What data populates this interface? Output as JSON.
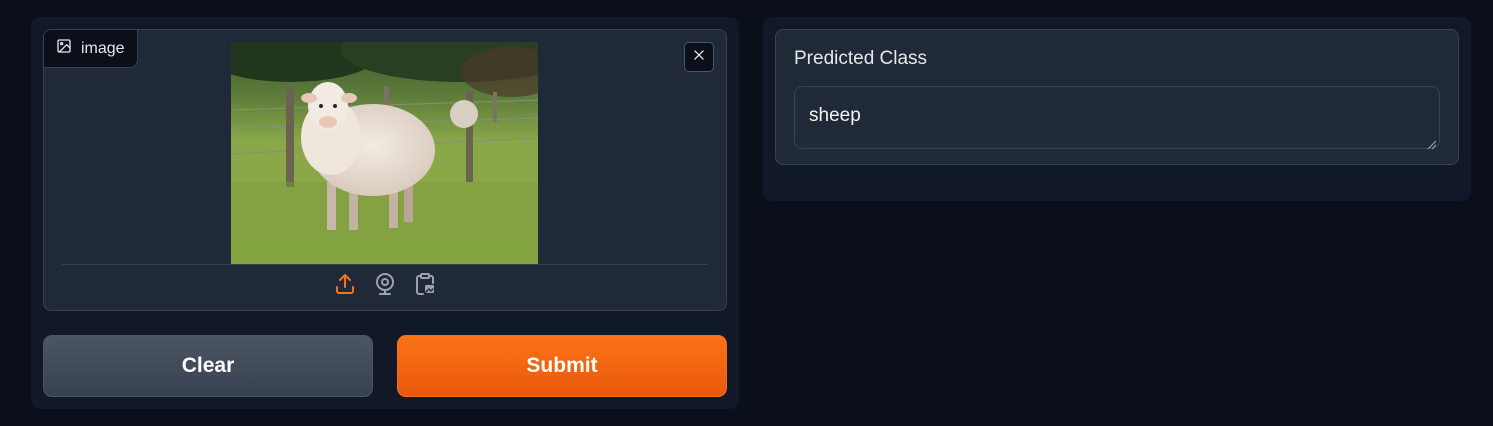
{
  "input": {
    "label": "image",
    "image_description_icon": "image-icon",
    "close_icon": "close-icon",
    "sources": [
      "upload-icon",
      "webcam-icon",
      "clipboard-icon"
    ]
  },
  "buttons": {
    "clear_label": "Clear",
    "submit_label": "Submit"
  },
  "output": {
    "label": "Predicted Class",
    "value": "sheep"
  },
  "colors": {
    "background": "#0b0f19",
    "panel": "#111827",
    "block": "#1f2937",
    "border": "#374151",
    "accent": "#f97316",
    "secondary_button": "#4b5563"
  }
}
